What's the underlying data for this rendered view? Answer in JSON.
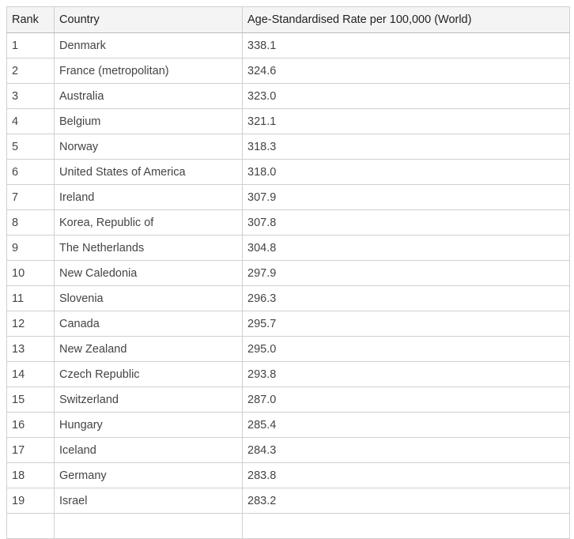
{
  "table": {
    "headers": [
      "Rank",
      "Country",
      "Age-Standardised Rate per 100,000 (World)"
    ],
    "rows": [
      [
        "1",
        "Denmark",
        "338.1"
      ],
      [
        "2",
        "France (metropolitan)",
        "324.6"
      ],
      [
        "3",
        "Australia",
        "323.0"
      ],
      [
        "4",
        "Belgium",
        "321.1"
      ],
      [
        "5",
        "Norway",
        "318.3"
      ],
      [
        "6",
        "United States of America",
        "318.0"
      ],
      [
        "7",
        "Ireland",
        "307.9"
      ],
      [
        "8",
        "Korea, Republic of",
        "307.8"
      ],
      [
        "9",
        "The Netherlands",
        "304.8"
      ],
      [
        "10",
        "New Caledonia",
        "297.9"
      ],
      [
        "11",
        "Slovenia",
        "296.3"
      ],
      [
        "12",
        "Canada",
        "295.7"
      ],
      [
        "13",
        "New Zealand",
        "295.0"
      ],
      [
        "14",
        "Czech Republic",
        "293.8"
      ],
      [
        "15",
        "Switzerland",
        "287.0"
      ],
      [
        "16",
        "Hungary",
        "285.4"
      ],
      [
        "17",
        "Iceland",
        "284.3"
      ],
      [
        "18",
        "Germany",
        "283.8"
      ],
      [
        "19",
        "Israel",
        "283.2"
      ],
      [
        "",
        "",
        ""
      ]
    ]
  }
}
